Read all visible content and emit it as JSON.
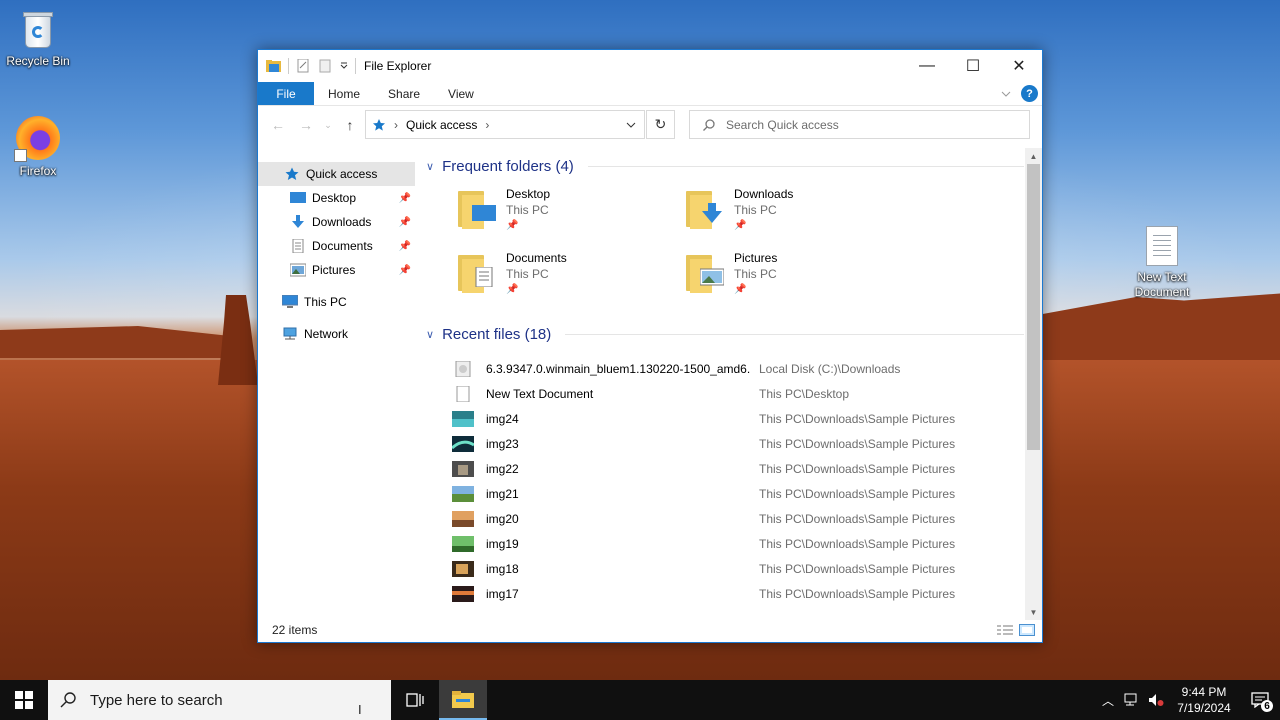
{
  "desktop": {
    "icons": [
      {
        "label": "Recycle Bin"
      },
      {
        "label": "Firefox"
      },
      {
        "label": "New Text Document"
      }
    ]
  },
  "window": {
    "title": "File Explorer",
    "controls": {
      "minimize": "—",
      "maximize": "☐",
      "close": "✕"
    },
    "tabs": {
      "file": "File",
      "home": "Home",
      "share": "Share",
      "view": "View"
    },
    "help": "?",
    "address": {
      "location": "Quick access"
    },
    "search": {
      "placeholder": "Search Quick access"
    },
    "nav_pane": {
      "quick_access": "Quick access",
      "items": [
        {
          "label": "Desktop"
        },
        {
          "label": "Downloads"
        },
        {
          "label": "Documents"
        },
        {
          "label": "Pictures"
        }
      ],
      "this_pc": "This PC",
      "network": "Network"
    },
    "frequent": {
      "header": "Frequent folders (4)",
      "folders": [
        {
          "name": "Desktop",
          "location": "This PC"
        },
        {
          "name": "Downloads",
          "location": "This PC"
        },
        {
          "name": "Documents",
          "location": "This PC"
        },
        {
          "name": "Pictures",
          "location": "This PC"
        }
      ]
    },
    "recent": {
      "header": "Recent files (18)",
      "files": [
        {
          "name": "6.3.9347.0.winmain_bluem1.130220-1500_amd6...",
          "location": "Local Disk (C:)\\Downloads"
        },
        {
          "name": "New Text Document",
          "location": "This PC\\Desktop"
        },
        {
          "name": "img24",
          "location": "This PC\\Downloads\\Sample Pictures"
        },
        {
          "name": "img23",
          "location": "This PC\\Downloads\\Sample Pictures"
        },
        {
          "name": "img22",
          "location": "This PC\\Downloads\\Sample Pictures"
        },
        {
          "name": "img21",
          "location": "This PC\\Downloads\\Sample Pictures"
        },
        {
          "name": "img20",
          "location": "This PC\\Downloads\\Sample Pictures"
        },
        {
          "name": "img19",
          "location": "This PC\\Downloads\\Sample Pictures"
        },
        {
          "name": "img18",
          "location": "This PC\\Downloads\\Sample Pictures"
        },
        {
          "name": "img17",
          "location": "This PC\\Downloads\\Sample Pictures"
        }
      ]
    },
    "status": {
      "items": "22 items"
    }
  },
  "taskbar": {
    "search_placeholder": "Type here to search",
    "time": "9:44 PM",
    "date": "7/19/2024",
    "notification_count": "6"
  },
  "colors": {
    "accent": "#1979ca",
    "group_header": "#1e3287",
    "selection": "#e5e5e5",
    "taskbar": "#101010"
  }
}
